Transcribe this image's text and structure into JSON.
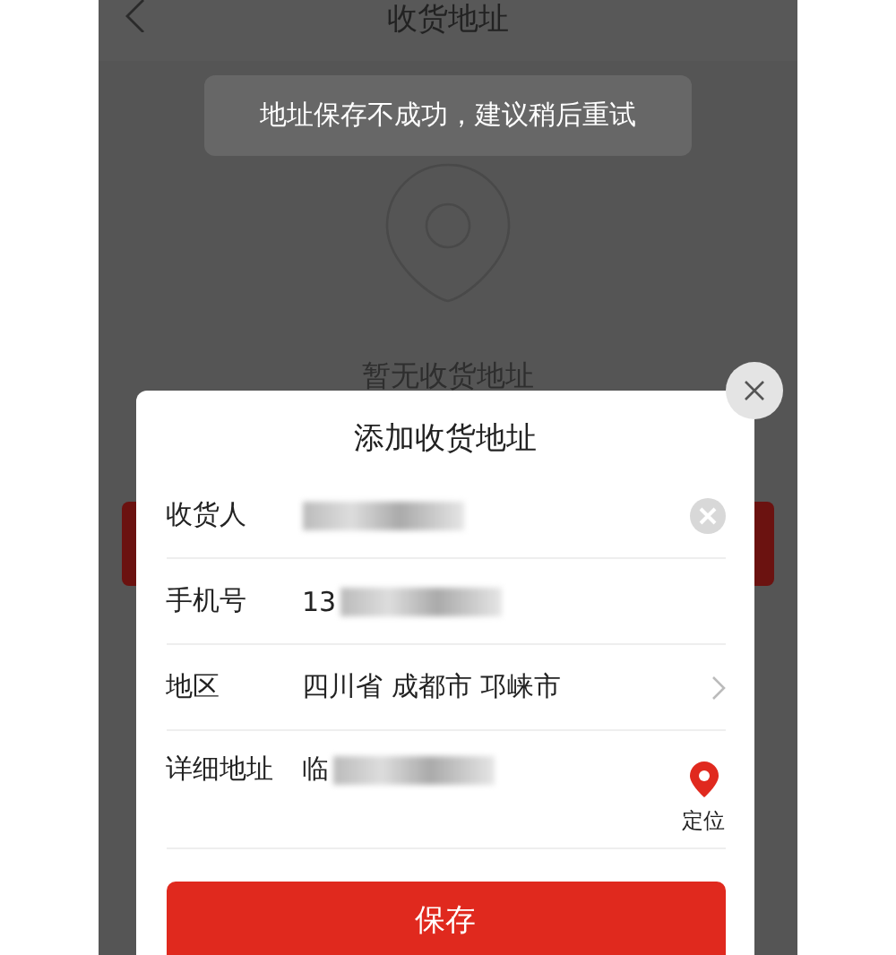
{
  "header": {
    "title": "收货地址"
  },
  "empty_state": {
    "text": "暂无收货地址"
  },
  "dialog": {
    "title": "添加收货地址",
    "fields": [
      {
        "kind": "clearable",
        "label": "收货人",
        "redacted": true
      },
      {
        "kind": "text",
        "label": "手机号",
        "value": "13",
        "redacted": true
      },
      {
        "kind": "select",
        "label": "地区",
        "value": "四川省 成都市 邛崃市",
        "redacted": false
      },
      {
        "kind": "locate",
        "label": "详细地址",
        "value": "临",
        "redacted": true,
        "action_label": "定位"
      }
    ],
    "save_button": "保存"
  },
  "toast": "地址保存不成功，建议稍后重试"
}
